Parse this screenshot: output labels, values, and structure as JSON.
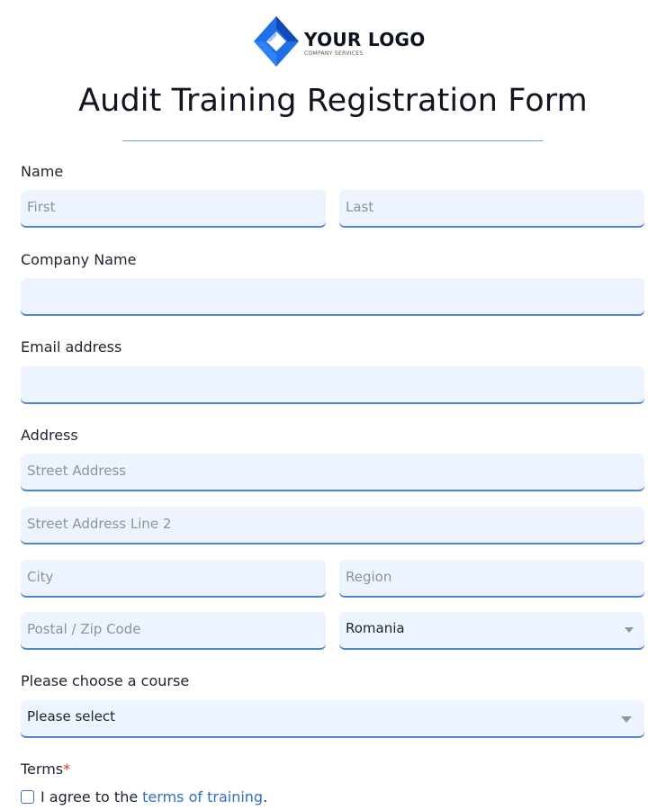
{
  "logo": {
    "title": "YOUR LOGO",
    "subtitle": "COMPANY SERVICES",
    "icon": "diamond-logo-icon",
    "colors": {
      "primary": "#1f6fe6",
      "dark": "#1248b8",
      "light": "#9ec6ff"
    }
  },
  "form": {
    "title": "Audit Training Registration Form",
    "name": {
      "label": "Name",
      "first_placeholder": "First",
      "last_placeholder": "Last"
    },
    "company": {
      "label": "Company Name",
      "value": ""
    },
    "email": {
      "label": "Email address",
      "value": ""
    },
    "address": {
      "label": "Address",
      "street_placeholder": "Street Address",
      "street2_placeholder": "Street Address Line 2",
      "city_placeholder": "City",
      "region_placeholder": "Region",
      "postal_placeholder": "Postal / Zip Code",
      "country_value": "Romania"
    },
    "course": {
      "label": "Please choose a course",
      "value": "Please select"
    },
    "terms": {
      "label": "Terms",
      "required_mark": "*",
      "agree_prefix": "I agree to the",
      "link_text": "terms of training",
      "suffix": "."
    }
  },
  "colors": {
    "field_bg": "#eef4ff",
    "field_border": "#4d87d4",
    "link": "#2f6fc6",
    "required": "#d23131"
  }
}
